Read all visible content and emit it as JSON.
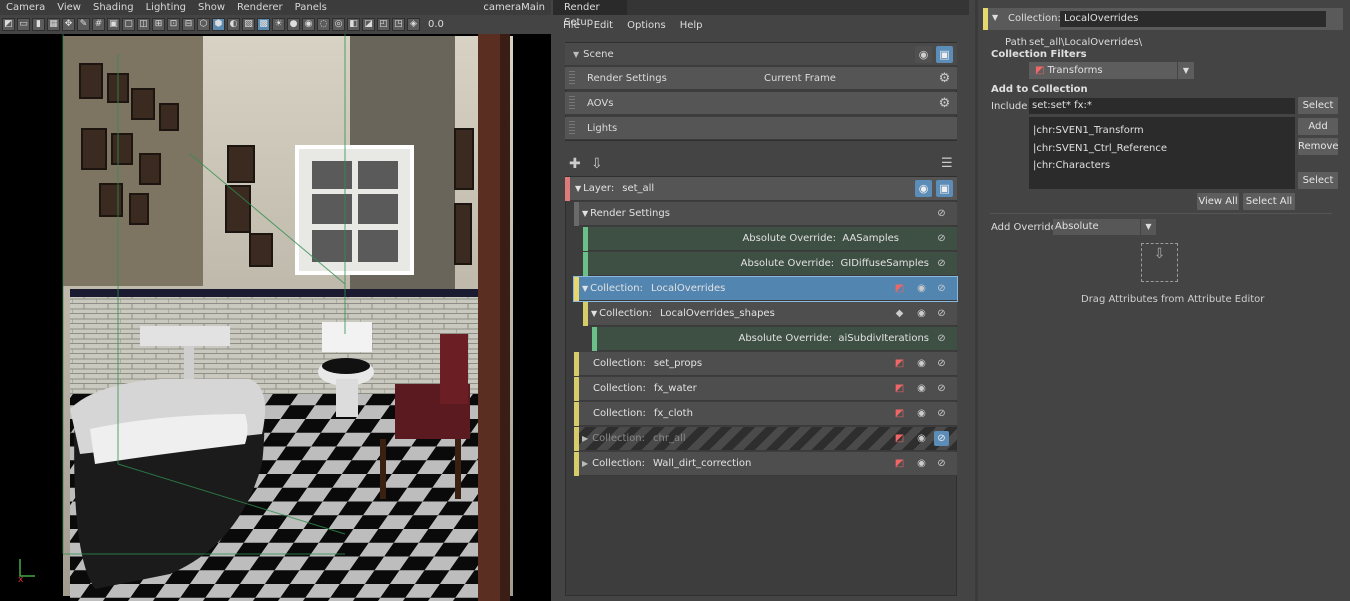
{
  "viewport": {
    "menu": [
      "Camera",
      "View",
      "Shading",
      "Lighting",
      "Show",
      "Renderer",
      "Panels"
    ],
    "camera": "cameraMain",
    "toolbar_value": "0.0",
    "axis_label": "x"
  },
  "render_setup": {
    "title": "Render Setup",
    "menu": [
      "File",
      "Edit",
      "Options",
      "Help"
    ],
    "scene_label": "Scene",
    "scene_items": [
      {
        "label": "Render Settings",
        "value": "Current Frame"
      },
      {
        "label": "AOVs",
        "value": ""
      },
      {
        "label": "Lights",
        "value": ""
      }
    ],
    "layer": {
      "prefix": "Layer:",
      "name": "set_all"
    },
    "tree": [
      {
        "kind": "settings",
        "label": "Render Settings",
        "indent": 0
      },
      {
        "kind": "override",
        "label": "Absolute Override:",
        "name": "AASamples"
      },
      {
        "kind": "override",
        "label": "Absolute Override:",
        "name": "GIDiffuseSamples"
      },
      {
        "kind": "collection",
        "label": "Collection:",
        "name": "LocalOverrides",
        "selected": true
      },
      {
        "kind": "subcollection",
        "label": "Collection:",
        "name": "LocalOverrides_shapes"
      },
      {
        "kind": "override2",
        "label": "Absolute Override:",
        "name": "aiSubdivIterations"
      },
      {
        "kind": "collection",
        "label": "Collection:",
        "name": "set_props"
      },
      {
        "kind": "collection",
        "label": "Collection:",
        "name": "fx_water"
      },
      {
        "kind": "collection",
        "label": "Collection:",
        "name": "fx_cloth"
      },
      {
        "kind": "disabled",
        "label": "Collection:",
        "name": "chr_all"
      },
      {
        "kind": "collection",
        "label": "Collection:",
        "name": "Wall_dirt_correction"
      }
    ]
  },
  "property_editor": {
    "header_label": "Collection:",
    "header_value": "LocalOverrides",
    "path_label": "Path",
    "path_value": "set_all\\LocalOverrides\\",
    "filters_title": "Collection Filters",
    "filter_value": "Transforms",
    "add_title": "Add to Collection",
    "include_label": "Include",
    "include_value": "set:set* fx:*",
    "select_btn": "Select",
    "add_btn": "Add",
    "remove_btn": "Remove",
    "select_btn2": "Select",
    "members": [
      "|chr:SVEN1_Transform",
      "|chr:SVEN1_Ctrl_Reference",
      "|chr:Characters"
    ],
    "view_all": "View All",
    "select_all": "Select All",
    "add_override_label": "Add Override",
    "add_override_value": "Absolute",
    "drag_hint": "Drag Attributes from Attribute Editor"
  }
}
